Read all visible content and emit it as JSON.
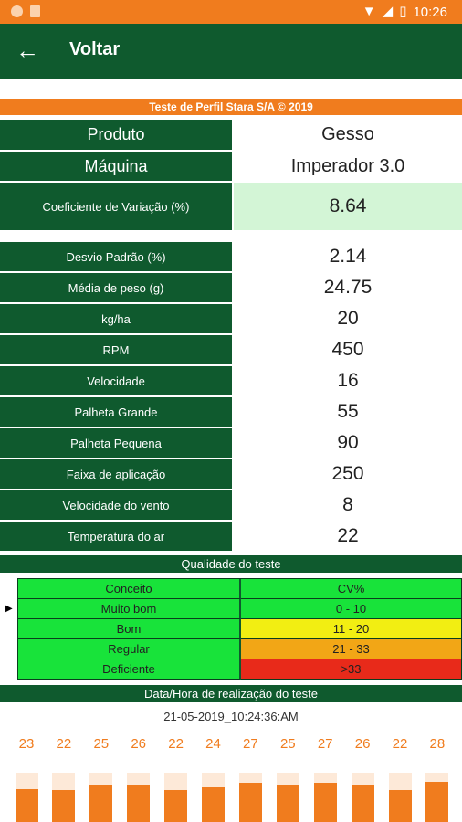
{
  "status_bar": {
    "time": "10:26",
    "icons": [
      "notification-dot-icon",
      "sd-card-icon",
      "wifi-icon",
      "signal-icon",
      "battery-icon"
    ]
  },
  "app_bar": {
    "back_label": "Voltar",
    "back_icon": "arrow-left-icon"
  },
  "banner": "Teste de Perfil Stara S/A © 2019",
  "info": {
    "produto_label": "Produto",
    "produto_value": "Gesso",
    "maquina_label": "Máquina",
    "maquina_value": "Imperador 3.0",
    "cv_label": "Coeficiente de Variação (%)",
    "cv_value": "8.64"
  },
  "params": [
    {
      "label": "Desvio Padrão (%)",
      "value": "2.14"
    },
    {
      "label": "Média de peso (g)",
      "value": "24.75"
    },
    {
      "label": "kg/ha",
      "value": "20"
    },
    {
      "label": "RPM",
      "value": "450"
    },
    {
      "label": "Velocidade",
      "value": "16"
    },
    {
      "label": "Palheta Grande",
      "value": "55"
    },
    {
      "label": "Palheta Pequena",
      "value": "90"
    },
    {
      "label": "Faixa de aplicação",
      "value": "250"
    },
    {
      "label": "Velocidade do vento",
      "value": "8"
    },
    {
      "label": "Temperatura do ar",
      "value": "22"
    }
  ],
  "quality": {
    "title": "Qualidade do teste",
    "header": {
      "col1": "Conceito",
      "col2": "CV%"
    },
    "rows": [
      {
        "concept": "Muito bom",
        "range": "0 - 10",
        "color": "#18e33a"
      },
      {
        "concept": "Bom",
        "range": "11 - 20",
        "color": "#f2ee12"
      },
      {
        "concept": "Regular",
        "range": "21 - 33",
        "color": "#f2a616"
      },
      {
        "concept": "Deficiente",
        "range": ">33",
        "color": "#e82a1a"
      }
    ]
  },
  "datetime": {
    "title": "Data/Hora de realização do teste",
    "value": "21-05-2019_10:24:36:AM"
  },
  "chart_data": {
    "type": "bar",
    "values": [
      23,
      22,
      25,
      26,
      22,
      24,
      27,
      25,
      27,
      26,
      22,
      28
    ]
  }
}
